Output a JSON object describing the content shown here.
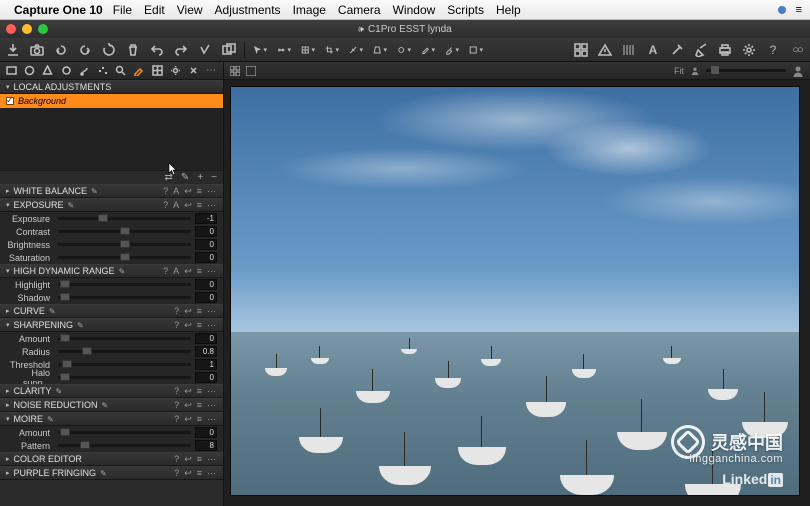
{
  "menubar": {
    "app": "Capture One 10",
    "items": [
      "File",
      "Edit",
      "View",
      "Adjustments",
      "Image",
      "Camera",
      "Window",
      "Scripts",
      "Help"
    ]
  },
  "window": {
    "title": "C1Pro ESST lynda"
  },
  "viewer": {
    "fit_label": "Fit"
  },
  "tooltabs_icons": [
    "library",
    "capture",
    "lens",
    "crop",
    "color",
    "brush",
    "mask",
    "pen",
    "grid",
    "gear",
    "scissors"
  ],
  "sections": {
    "local_adjustments": {
      "title": "LOCAL ADJUSTMENTS",
      "layers": [
        {
          "name": "Background",
          "checked": true
        }
      ]
    },
    "white_balance": {
      "title": "WHITE BALANCE",
      "expanded": false
    },
    "exposure": {
      "title": "EXPOSURE",
      "expanded": true,
      "sliders": [
        {
          "label": "Exposure",
          "value": "-1",
          "pos": 34
        },
        {
          "label": "Contrast",
          "value": "0",
          "pos": 50
        },
        {
          "label": "Brightness",
          "value": "0",
          "pos": 50
        },
        {
          "label": "Saturation",
          "value": "0",
          "pos": 50
        }
      ]
    },
    "hdr": {
      "title": "HIGH DYNAMIC RANGE",
      "expanded": true,
      "sliders": [
        {
          "label": "Highlight",
          "value": "0",
          "pos": 5
        },
        {
          "label": "Shadow",
          "value": "0",
          "pos": 5
        }
      ]
    },
    "curve": {
      "title": "CURVE",
      "expanded": false
    },
    "sharpening": {
      "title": "SHARPENING",
      "expanded": true,
      "sliders": [
        {
          "label": "Amount",
          "value": "0",
          "pos": 5
        },
        {
          "label": "Radius",
          "value": "0.8",
          "pos": 22
        },
        {
          "label": "Threshold",
          "value": "1",
          "pos": 7
        },
        {
          "label": "Halo supp...",
          "value": "0",
          "pos": 5
        }
      ]
    },
    "clarity": {
      "title": "CLARITY",
      "expanded": false
    },
    "noise": {
      "title": "NOISE REDUCTION",
      "expanded": false
    },
    "moire": {
      "title": "MOIRE",
      "expanded": true,
      "sliders": [
        {
          "label": "Amount",
          "value": "0",
          "pos": 5
        },
        {
          "label": "Pattern",
          "value": "8",
          "pos": 20
        }
      ]
    },
    "color_editor": {
      "title": "COLOR EDITOR",
      "expanded": false
    },
    "purple_fringing": {
      "title": "PURPLE FRINGING",
      "expanded": false
    }
  },
  "watermark": {
    "main": "灵感中国",
    "sub": "lingganchina.com"
  },
  "footer_brand": "Linked"
}
